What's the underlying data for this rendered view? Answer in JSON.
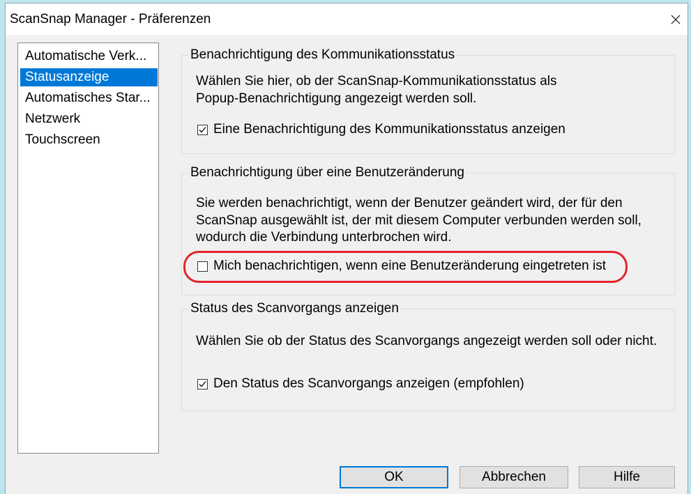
{
  "window": {
    "title": "ScanSnap Manager - Präferenzen"
  },
  "icons": {
    "close": "close-icon",
    "checkmark": "checkmark-icon"
  },
  "colors": {
    "desktop": "#bfe4ee",
    "dialog": "#f0f0f0",
    "selection": "#0078d7",
    "highlight": "#e3222b",
    "default_button_border": "#0078d7"
  },
  "sidebar": {
    "items": [
      {
        "label": "Automatische Verk...",
        "selected": false
      },
      {
        "label": "Statusanzeige",
        "selected": true
      },
      {
        "label": "Automatisches Star...",
        "selected": false
      },
      {
        "label": "Netzwerk",
        "selected": false
      },
      {
        "label": "Touchscreen",
        "selected": false
      }
    ]
  },
  "groups": {
    "communication_status": {
      "legend": "Benachrichtigung des Kommunikationsstatus",
      "description": [
        "Wählen Sie hier, ob der ScanSnap-Kommunikationsstatus als",
        "Popup-Benachrichtigung angezeigt werden soll."
      ],
      "checkbox": {
        "label": "Eine Benachrichtigung des Kommunikationsstatus anzeigen",
        "checked": true
      }
    },
    "user_change": {
      "legend": "Benachrichtigung über eine Benutzeränderung",
      "description": [
        "Sie werden benachrichtigt, wenn der Benutzer geändert wird, der für den",
        "ScanSnap ausgewählt ist, der mit diesem Computer verbunden werden soll,",
        "wodurch die Verbindung unterbrochen wird."
      ],
      "checkbox": {
        "label": "Mich benachrichtigen, wenn eine Benutzeränderung eingetreten ist",
        "checked": false,
        "highlighted": true
      }
    },
    "scan_status": {
      "legend": "Status des Scanvorgangs anzeigen",
      "description": [
        "Wählen Sie ob der Status des Scanvorgangs angezeigt werden soll oder nicht."
      ],
      "checkbox": {
        "label": "Den Status des Scanvorgangs anzeigen (empfohlen)",
        "checked": true
      }
    }
  },
  "buttons": {
    "ok": {
      "label": "OK",
      "default": true
    },
    "cancel": {
      "label": "Abbrechen",
      "default": false
    },
    "help": {
      "label": "Hilfe",
      "default": false
    }
  }
}
